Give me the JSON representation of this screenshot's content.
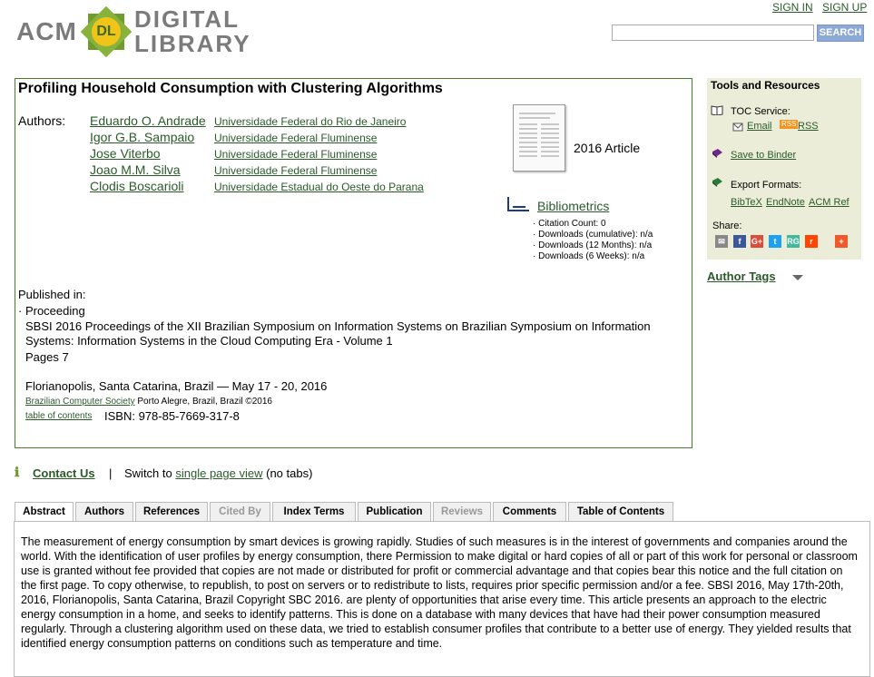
{
  "header": {
    "logo": {
      "acm": "ACM",
      "dl": "DL",
      "word1": "DIGITAL",
      "word2": "LIBRARY"
    },
    "sign_in": "SIGN IN",
    "sign_up": "SIGN UP",
    "search_value": "",
    "search_button": "SEARCH"
  },
  "article": {
    "title": "Profiling Household Consumption with Clustering Algorithms",
    "authors_label": "Authors:",
    "authors": [
      {
        "name": "Eduardo O. Andrade",
        "affiliation": "Universidade Federal do Rio de Janeiro"
      },
      {
        "name": "Igor G.B. Sampaio",
        "affiliation": "Universidade Federal Fluminense"
      },
      {
        "name": "Jose Viterbo",
        "affiliation": "Universidade Federal Fluminense"
      },
      {
        "name": "Joao M.M. Silva",
        "affiliation": "Universidade Federal Fluminense"
      },
      {
        "name": "Clodis Boscarioli",
        "affiliation": "Universidade Estadual do Oeste do Parana"
      }
    ],
    "type": "2016 Article",
    "bibliometrics": "Bibliometrics",
    "stats": [
      "· Citation Count: 0",
      "· Downloads (cumulative): n/a",
      "· Downloads (12 Months): n/a",
      "· Downloads (6 Weeks): n/a"
    ],
    "published_in_label": "Published in:",
    "proceeding_label": "· Proceeding",
    "proceeding_name": "SBSI 2016 Proceedings of the XII Brazilian Symposium on Information Systems on Brazilian Symposium on Information Systems: Information Systems in the Cloud Computing Era - Volume 1",
    "pages": "Pages 7",
    "location": "Florianopolis, Santa Catarina, Brazil — May 17 - 20, 2016",
    "publisher_link": "Brazilian Computer Society",
    "publisher_rest": "Porto Alegre, Brazil, Brazil ©2016",
    "toc_link": "table of contents",
    "isbn": "ISBN: 978-85-7669-317-8"
  },
  "sidebar": {
    "title": "Tools and Resources",
    "toc_service": "TOC Service:",
    "email": "Email",
    "rss_badge": "RSS",
    "rss": "RSS",
    "save_binder": "Save to Binder",
    "export_label": "Export Formats:",
    "export_formats": [
      "BibTeX",
      "EndNote",
      "ACM Ref"
    ],
    "share_label": "Share:",
    "share_icons": [
      {
        "name": "email",
        "glyph": "✉",
        "color": "#888888"
      },
      {
        "name": "facebook",
        "glyph": "f",
        "color": "#3b5998"
      },
      {
        "name": "google-plus",
        "glyph": "G+",
        "color": "#dd4b39"
      },
      {
        "name": "twitter",
        "glyph": "t",
        "color": "#1da1f2"
      },
      {
        "name": "researchgate",
        "glyph": "RG",
        "color": "#40ba9b"
      },
      {
        "name": "reddit",
        "glyph": "r",
        "color": "#ff4500"
      },
      {
        "name": "more",
        "glyph": "+",
        "color": "#f05a2a"
      }
    ]
  },
  "author_tags": "Author Tags",
  "contact": {
    "icon": "ℹ",
    "label": "Contact Us",
    "separator": "|",
    "switch_prefix": "Switch to",
    "switch_link": "single page view",
    "switch_suffix": "(no tabs)"
  },
  "tabs": [
    {
      "label": "Abstract",
      "state": "active"
    },
    {
      "label": "Authors",
      "state": "normal"
    },
    {
      "label": "References",
      "state": "normal"
    },
    {
      "label": "Cited By",
      "state": "disabled"
    },
    {
      "label": "Index Terms",
      "state": "normal"
    },
    {
      "label": "Publication",
      "state": "normal"
    },
    {
      "label": "Reviews",
      "state": "disabled"
    },
    {
      "label": "Comments",
      "state": "normal"
    },
    {
      "label": "Table of Contents",
      "state": "normal"
    }
  ],
  "abstract": "The measurement of energy consumption by smart devices is growing rapidly. Studies of such measures is in the interest of governments and companies around the world. With the identification of user profiles by energy consumption, there Permission to make digital or hard copies of all or part of this work for personal or classroom use is granted without fee provided that copies are not made or distributed for profit or commercial advantage and that copies bear this notice and the full citation on the first page. To copy otherwise, to republish, to post on servers or to redistribute to lists, requires prior specific permission and/or a fee. SBSI 2016, May 17th-20th, 2016, Florianopolis, Santa Catarina, Brazil Copyright SBC 2016. are plenty of opportunities that arise every time. This article presents an approach to the electric energy consumption in a home, and seeks to identify patterns. This is done on a database with many devices that have had their power consumption measured regularly. Through a clustering algorithm used on these data, we tried to establish consumer profiles that contribute to a better use of energy. They yielded results that identified energy consumption patterns on conditions such as temperature and time."
}
